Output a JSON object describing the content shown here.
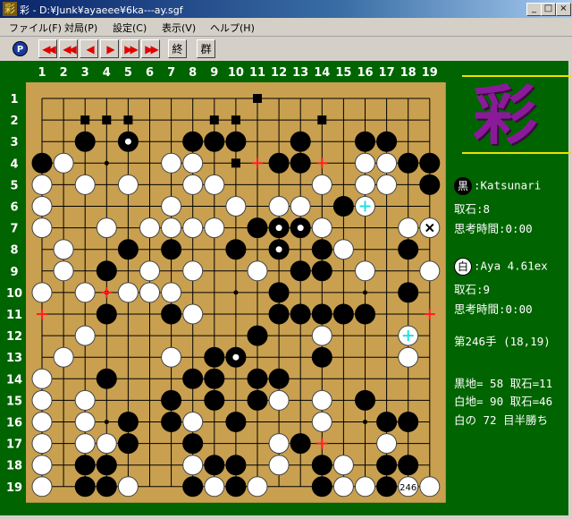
{
  "window": {
    "title": "彩 - D:¥Junk¥ayaeee¥6ka---ay.sgf",
    "icon_char": "彩",
    "min_glyph": "_",
    "max_glyph": "□",
    "close_glyph": "×"
  },
  "menu": [
    "ファイル(F)",
    "対局(P)",
    "設定(C)",
    "表示(V)",
    "ヘルプ(H)"
  ],
  "toolbar": {
    "p_label": "P",
    "nav": [
      "◀◀",
      "◀◀",
      "◀",
      "▶",
      "▶▶",
      "▶▶"
    ],
    "end_label": "終",
    "group_label": "群"
  },
  "board": {
    "size": 19,
    "col_labels": [
      "1",
      "2",
      "3",
      "4",
      "5",
      "6",
      "7",
      "8",
      "9",
      "10",
      "11",
      "12",
      "13",
      "14",
      "15",
      "16",
      "17",
      "18",
      "19"
    ],
    "row_labels": [
      "1",
      "2",
      "3",
      "4",
      "5",
      "6",
      "7",
      "8",
      "9",
      "10",
      "11",
      "12",
      "13",
      "14",
      "15",
      "16",
      "17",
      "18",
      "19"
    ],
    "rows": [
      "..........m........",
      "..mmm...mm...m.....",
      "..X.x..XXX..X..XX..",
      "XO....OO.m.XX..OOXX",
      "O.O.O..OO....O.OO.X",
      "O.....O..O.OO.XO...",
      "O..O.OOOO.XxxO...Oo",
      ".O..X.X..X.x.XO..X.",
      ".O.X.O.O..O.XX.O..O",
      "O.O.OOO....X.....X.",
      "...X..XO...XXXXX...",
      "..O.......X..O...O.",
      ".O....O.Xx...X...O.",
      "O..X...XX.XX.......",
      "O.O...X.X.XO.O.X...",
      "O.O.X.XO.X...O..XX.",
      "O.OOX..X...OX...O..",
      "O.XX...OXX.O.XO.XX.",
      "O.XXO..XOXO..XOOX.O"
    ],
    "move_number_label": "246"
  },
  "sidebar": {
    "logo_char": "彩",
    "black_badge": "黒",
    "black_player": ":Katsunari",
    "black_captures": "取石:8",
    "black_time": "思考時間:0:00",
    "white_badge": "白",
    "white_player": ":Aya 4.61ex",
    "white_captures": "取石:9",
    "white_time": "思考時間:0:00",
    "move_info": "第246手 (18,19)",
    "black_territory": "黒地= 58 取石=11",
    "white_territory": "白地= 90 取石=46",
    "result": "白の 72 目半勝ち"
  },
  "colors": {
    "board_bg": "#c8a050",
    "background": "#006400",
    "label_bg": "#b8b8a8",
    "accent_red": "#ff2020",
    "accent_cyan": "#20e0e0",
    "logo_purple": "#8b1a9b",
    "logo_line": "#f0e000"
  }
}
